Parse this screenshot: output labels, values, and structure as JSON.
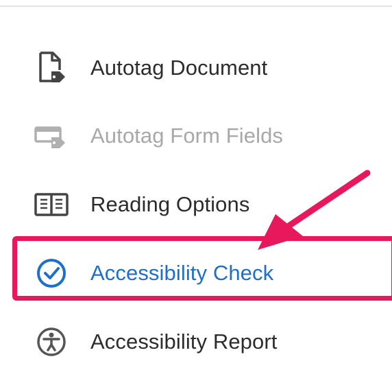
{
  "menu": {
    "items": [
      {
        "label": "Autotag Document",
        "icon": "document-tag-icon",
        "state": "normal"
      },
      {
        "label": "Autotag Form Fields",
        "icon": "form-field-tag-icon",
        "state": "disabled"
      },
      {
        "label": "Reading Options",
        "icon": "open-book-icon",
        "state": "normal"
      },
      {
        "label": "Accessibility Check",
        "icon": "checkmark-circle-icon",
        "state": "highlighted"
      },
      {
        "label": "Accessibility Report",
        "icon": "accessibility-person-icon",
        "state": "normal"
      }
    ]
  },
  "annotation": {
    "highlight_color": "#e8185c",
    "arrow_color": "#e8185c",
    "target": "Accessibility Check"
  },
  "colors": {
    "text": "#2c2c2c",
    "disabled_text": "#a8a8a8",
    "active_text": "#1f6fc9",
    "icon_gray": "#555555"
  }
}
